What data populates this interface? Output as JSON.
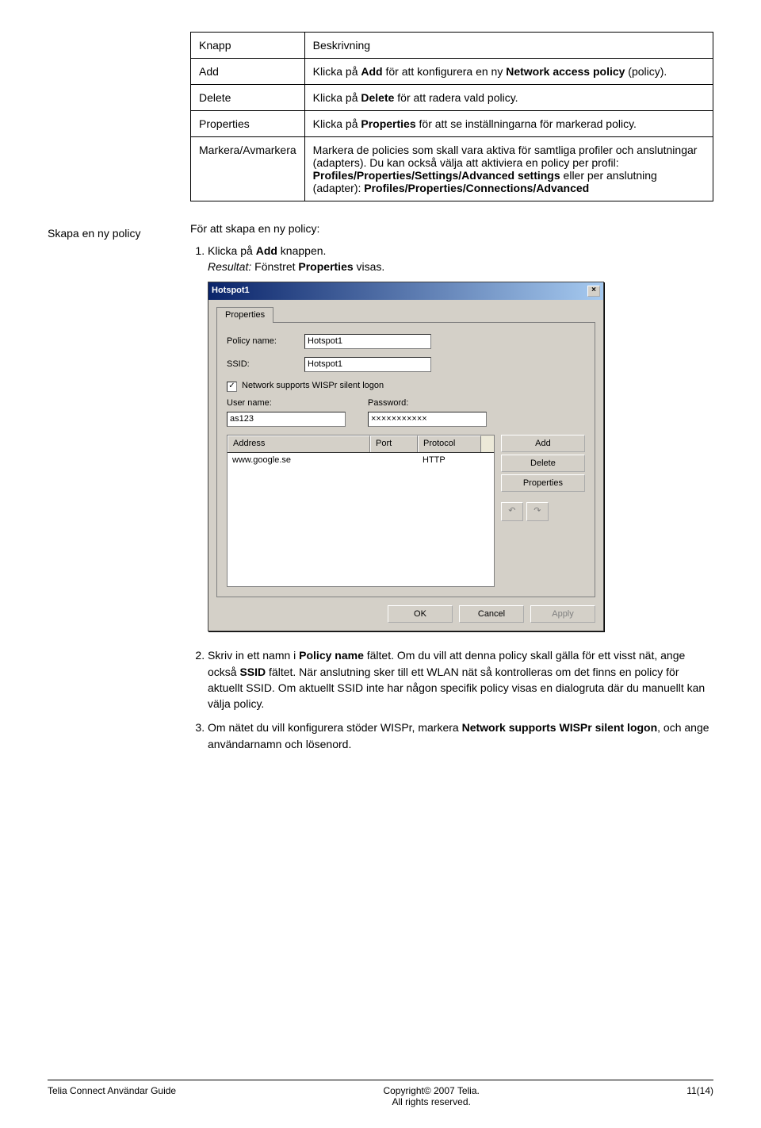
{
  "table": {
    "header": {
      "col1": "Knapp",
      "col2": "Beskrivning"
    },
    "rows": [
      {
        "label": "Add",
        "ptext": "Klicka på ",
        "bold1": "Add",
        "mid1": " för att konfigurera en ny ",
        "bold2": "Network access policy",
        "tail": " (policy)."
      },
      {
        "label": "Delete",
        "ptext": "Klicka på ",
        "bold1": "Delete",
        "mid1": " för att radera vald policy.",
        "bold2": "",
        "tail": ""
      },
      {
        "label": "Properties",
        "ptext": "Klicka på ",
        "bold1": "Properties",
        "mid1": " för att se inställningarna för markerad policy.",
        "bold2": "",
        "tail": ""
      },
      {
        "label": "Markera/Avmarkera",
        "ptext": "Markera de policies som skall vara aktiva för samtliga profiler och anslutningar (adapters). Du kan också välja att aktiviera en policy per profil: ",
        "bold1": "Profiles/Properties/Settings/Advanced settings",
        "mid1": " eller per anslutning (adapter): ",
        "bold2": "Profiles/Properties/Connections/Advanced",
        "tail": ""
      }
    ]
  },
  "section": {
    "label": "Skapa en ny policy",
    "intro": "För att skapa en ny policy:"
  },
  "steps": {
    "s1a": "Klicka på ",
    "s1b": "Add",
    "s1c": " knappen.",
    "s1res_i": "Resultat:",
    "s1res_t": " Fönstret ",
    "s1res_b": "Properties",
    "s1res_e": " visas.",
    "s2a": "Skriv in ett namn i ",
    "s2b": "Policy name",
    "s2c": " fältet. Om du vill att denna policy skall gälla för ett visst nät, ange också ",
    "s2d": "SSID",
    "s2e": " fältet. När anslutning sker till ett WLAN nät så kontrolleras om det finns en policy för aktuellt SSID. Om aktuellt SSID inte har någon specifik policy visas en dialogruta där du manuellt kan välja policy.",
    "s3a": "Om nätet du vill konfigurera stöder WISPr, markera ",
    "s3b": "Network supports WISPr silent logon",
    "s3c": ", och ange användarnamn och lösenord."
  },
  "dialog": {
    "title": "Hotspot1",
    "tab": "Properties",
    "labels": {
      "policy": "Policy name:",
      "ssid": "SSID:",
      "cb": "Network supports WISPr silent logon",
      "user": "User name:",
      "pass": "Password:",
      "hdr_addr": "Address",
      "hdr_port": "Port",
      "hdr_proto": "Protocol"
    },
    "values": {
      "policy": "Hotspot1",
      "ssid": "Hotspot1",
      "cbcheck": "✓",
      "user": "as123",
      "pass": "×××××××××××",
      "row_addr": "www.google.se",
      "row_port": "",
      "row_proto": "HTTP"
    },
    "buttons": {
      "add": "Add",
      "delete": "Delete",
      "props": "Properties",
      "ok": "OK",
      "cancel": "Cancel",
      "apply": "Apply",
      "close": "×",
      "undo": "↶",
      "redo": "↷"
    }
  },
  "footer": {
    "left": "Telia Connect Användar Guide",
    "mid1": "Copyright© 2007 Telia.",
    "mid2": "All rights reserved.",
    "right": "11(14)"
  }
}
